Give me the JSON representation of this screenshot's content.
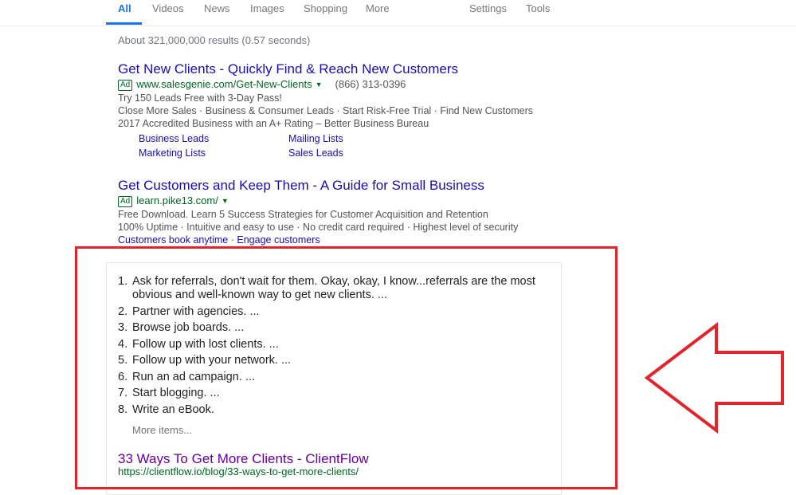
{
  "tabs": {
    "all": "All",
    "videos": "Videos",
    "news": "News",
    "images": "Images",
    "shopping": "Shopping",
    "more": "More",
    "settings": "Settings",
    "tools": "Tools"
  },
  "result_stats": "About 321,000,000 results (0.57 seconds)",
  "ads": [
    {
      "title": "Get New Clients - Quickly Find & Reach New Customers",
      "badge": "Ad",
      "url": "www.salesgenie.com/Get-New-Clients",
      "phone": "(866) 313-0396",
      "lines": [
        "Try 150 Leads Free with 3-Day Pass!",
        "Close More Sales · Business & Consumer Leads · Start Risk-Free Trial · Find New Customers",
        "2017 Accredited Business with an A+ Rating – Better Business Bureau"
      ],
      "sitelinks": [
        "Business Leads",
        "Mailing Lists",
        "Marketing Lists",
        "Sales Leads"
      ]
    },
    {
      "title": "Get Customers and Keep Them - A Guide for Small Business",
      "badge": "Ad",
      "url": "learn.pike13.com/",
      "lines": [
        "Free Download. Learn 5 Success Strategies for Customer Acquisition and Retention",
        "100% Uptime · Intuitive and easy to use · No credit card required · Highest level of security"
      ],
      "inline_links": [
        "Customers book anytime",
        "Engage customers"
      ],
      "inline_sep": " · "
    }
  ],
  "snippet": {
    "items": [
      {
        "num": "1.",
        "text": "Ask for referrals, don't wait for them. Okay, okay, I know...referrals are the most obvious and well-known way to get new clients. ..."
      },
      {
        "num": "2.",
        "text": "Partner with agencies. ..."
      },
      {
        "num": "3.",
        "text": "Browse job boards. ..."
      },
      {
        "num": "4.",
        "text": "Follow up with lost clients. ..."
      },
      {
        "num": "5.",
        "text": "Follow up with your network. ..."
      },
      {
        "num": "6.",
        "text": "Run an ad campaign. ..."
      },
      {
        "num": "7.",
        "text": "Start blogging. ..."
      },
      {
        "num": "8.",
        "text": "Write an eBook."
      }
    ],
    "more_items": "More items...",
    "title": "33 Ways To Get More Clients - ClientFlow",
    "url": "https://clientflow.io/blog/33-ways-to-get-more-clients/"
  },
  "colors": {
    "link": "#1a0dab",
    "visited": "#660099",
    "url_green": "#006621",
    "highlight_red": "#e2252c",
    "active_tab": "#1a73e8"
  },
  "icons": [
    "dropdown-caret-icon",
    "left-arrow-annotation-icon"
  ]
}
